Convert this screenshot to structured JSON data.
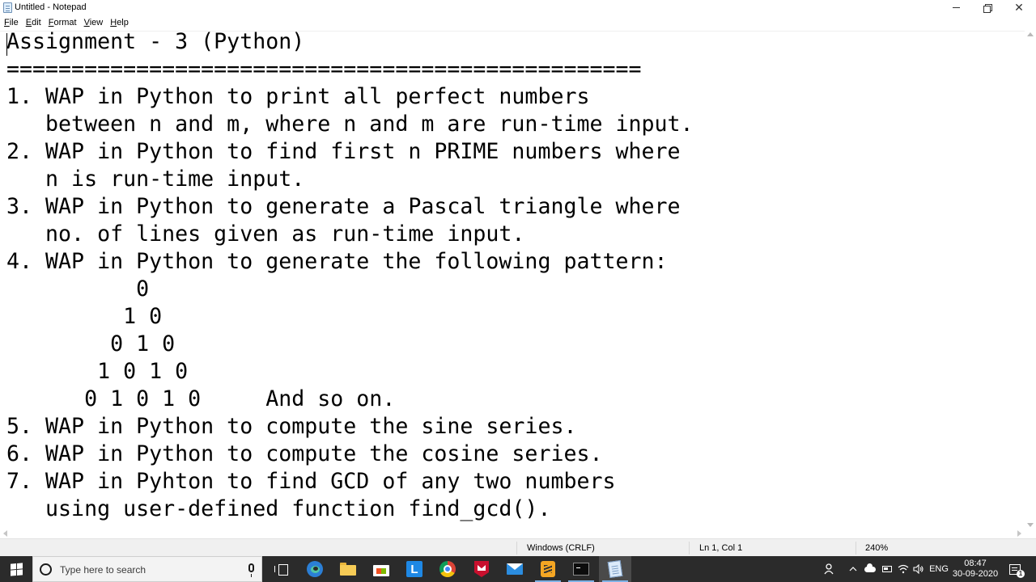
{
  "window": {
    "title": "Untitled - Notepad",
    "minimize_symbol": "",
    "close_symbol": "✕"
  },
  "menu": {
    "items": [
      {
        "first": "F",
        "rest": "ile"
      },
      {
        "first": "E",
        "rest": "dit"
      },
      {
        "first": "F",
        "rest": "ormat"
      },
      {
        "first": "V",
        "rest": "iew"
      },
      {
        "first": "H",
        "rest": "elp"
      }
    ]
  },
  "editor": {
    "lines": [
      "Assignment - 3 (Python)",
      "=================================================",
      "1. WAP in Python to print all perfect numbers",
      "   between n and m, where n and m are run-time input.",
      "2. WAP in Python to find first n PRIME numbers where",
      "   n is run-time input.",
      "3. WAP in Python to generate a Pascal triangle where",
      "   no. of lines given as run-time input.",
      "4. WAP in Python to generate the following pattern:",
      "          0",
      "         1 0",
      "        0 1 0",
      "       1 0 1 0",
      "      0 1 0 1 0     And so on.",
      "5. WAP in Python to compute the sine series.",
      "6. WAP in Python to compute the cosine series.",
      "7. WAP in Pyhton to find GCD of any two numbers",
      "   using user-defined function find_gcd()."
    ]
  },
  "status": {
    "line_ending": "Windows (CRLF)",
    "cursor": "Ln 1, Col 1",
    "zoom": "240%"
  },
  "taskbar": {
    "search_placeholder": "Type here to search",
    "lapp_letter": "L",
    "language": "ENG",
    "time": "08:47",
    "date": "30-09-2020",
    "notification_count": "1"
  }
}
